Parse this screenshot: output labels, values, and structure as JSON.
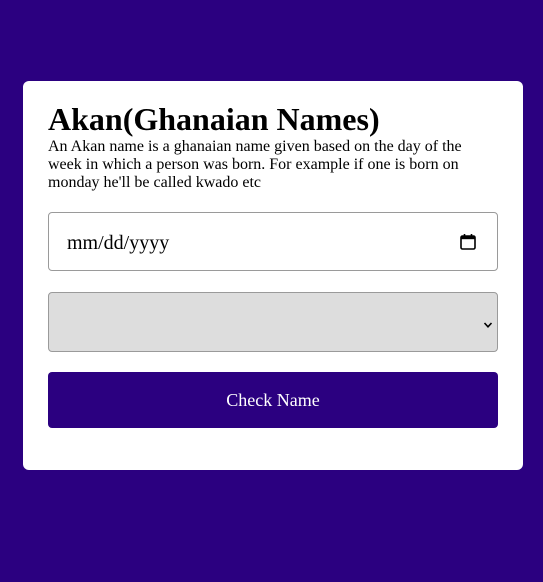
{
  "colors": {
    "page_background": "#2b0080",
    "card_background": "#ffffff",
    "button_background": "#2b0080",
    "button_text": "#ffffff",
    "select_background": "#dddddd"
  },
  "card": {
    "title": "Akan(Ghanaian Names)",
    "description": "An Akan name is a ghanaian name given based on the day of the week in which a person was born. For example if one is born on monday he'll be called kwado etc"
  },
  "form": {
    "date_input": {
      "placeholder": "mm/dd/yyyy",
      "value": "",
      "icon": "calendar-icon"
    },
    "gender_select": {
      "selected": "",
      "icon": "chevron-down-icon"
    },
    "submit_label": "Check Name"
  }
}
